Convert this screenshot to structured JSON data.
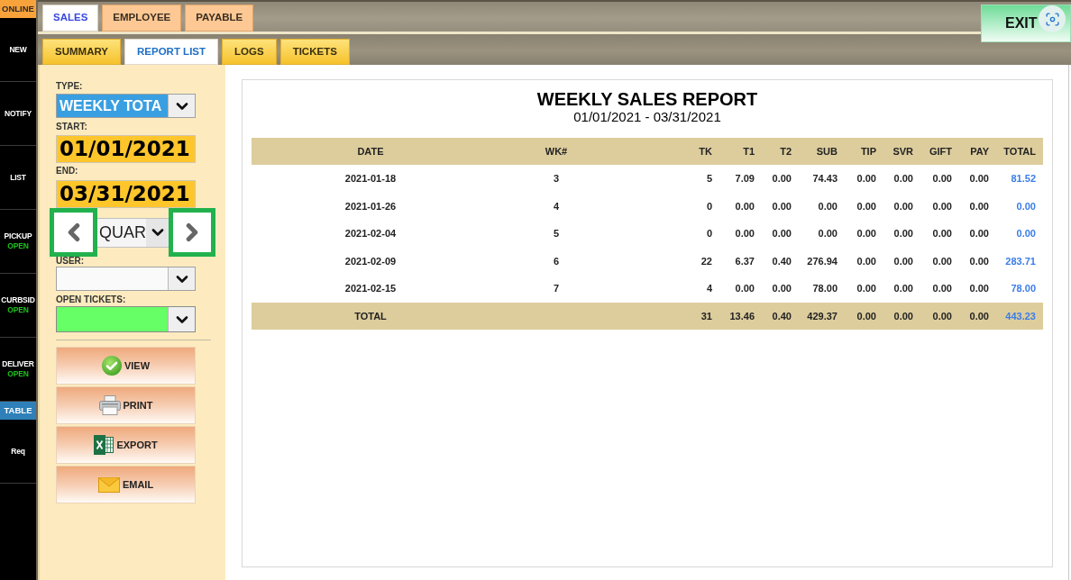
{
  "sidebar": {
    "items": [
      {
        "kind": "status",
        "label": "ONLINE"
      },
      {
        "kind": "nav",
        "label": "NEW"
      },
      {
        "kind": "nav",
        "label": "NOTIFY"
      },
      {
        "kind": "nav",
        "label": "LIST"
      },
      {
        "kind": "nav",
        "label": "PICKUP",
        "status": "OPEN"
      },
      {
        "kind": "nav",
        "label": "CURBSID",
        "status": "OPEN"
      },
      {
        "kind": "nav",
        "label": "DELIVER",
        "status": "OPEN"
      },
      {
        "kind": "toggle",
        "label": "TABLE",
        "on": true
      },
      {
        "kind": "nav",
        "label": "Req"
      }
    ]
  },
  "tabs": [
    {
      "label": "SALES",
      "selected": true
    },
    {
      "label": "EMPLOYEE",
      "selected": false
    },
    {
      "label": "PAYABLE",
      "selected": false
    }
  ],
  "exit_button": {
    "label": "EXIT"
  },
  "subtabs": [
    {
      "label": "SUMMARY",
      "selected": false
    },
    {
      "label": "REPORT LIST",
      "selected": true
    },
    {
      "label": "LOGS",
      "selected": false
    },
    {
      "label": "TICKETS",
      "selected": false
    }
  ],
  "filters": {
    "type": {
      "label": "TYPE:",
      "value": "WEEKLY TOTA",
      "focused": true
    },
    "start": {
      "label": "START:",
      "value": "01/01/2021"
    },
    "end": {
      "label": "END:",
      "value": "03/31/2021"
    },
    "period": {
      "value": "QUAR",
      "prev_highlighted": true,
      "next_highlighted": true
    },
    "user": {
      "label": "USER:"
    },
    "open_tickets": {
      "label": "OPEN TICKETS:"
    }
  },
  "actions": [
    {
      "kind": "view",
      "label": "VIEW"
    },
    {
      "kind": "print",
      "label": "PRINT"
    },
    {
      "kind": "export",
      "label": "EXPORT"
    },
    {
      "kind": "email",
      "label": "EMAIL"
    }
  ],
  "report": {
    "title": "WEEKLY SALES REPORT",
    "subtitle": "01/01/2021 - 03/31/2021",
    "columns": [
      "DATE",
      "WK#",
      "TK",
      "T1",
      "T2",
      "SUB",
      "TIP",
      "SVR",
      "GIFT",
      "PAY",
      "TOTAL"
    ],
    "rows": [
      [
        "2021-01-18",
        "3",
        "5",
        "7.09",
        "0.00",
        "74.43",
        "0.00",
        "0.00",
        "0.00",
        "0.00",
        "81.52"
      ],
      [
        "2021-01-26",
        "4",
        "0",
        "0.00",
        "0.00",
        "0.00",
        "0.00",
        "0.00",
        "0.00",
        "0.00",
        "0.00"
      ],
      [
        "2021-02-04",
        "5",
        "0",
        "0.00",
        "0.00",
        "0.00",
        "0.00",
        "0.00",
        "0.00",
        "0.00",
        "0.00"
      ],
      [
        "2021-02-09",
        "6",
        "22",
        "6.37",
        "0.40",
        "276.94",
        "0.00",
        "0.00",
        "0.00",
        "0.00",
        "283.71"
      ],
      [
        "2021-02-15",
        "7",
        "4",
        "0.00",
        "0.00",
        "78.00",
        "0.00",
        "0.00",
        "0.00",
        "0.00",
        "78.00"
      ]
    ],
    "total": {
      "label": "TOTAL",
      "values": [
        "31",
        "13.46",
        "0.40",
        "429.37",
        "0.00",
        "0.00",
        "0.00",
        "0.00",
        "443.23"
      ]
    }
  }
}
